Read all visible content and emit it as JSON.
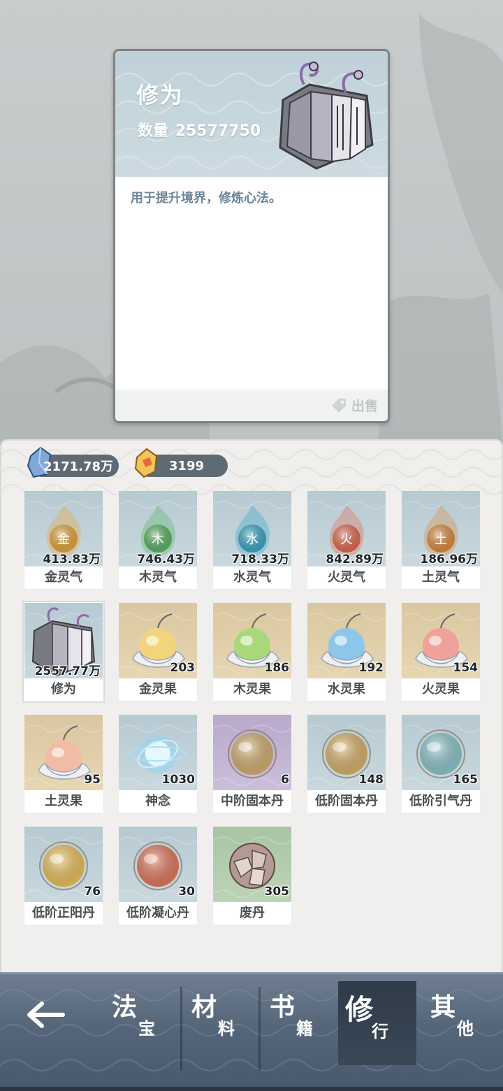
{
  "detail": {
    "title": "修为",
    "quantity_label": "数量",
    "quantity_value": "25577750",
    "description": "用于提升境界，修炼心法。",
    "sell_label": "出售"
  },
  "currencies": [
    {
      "icon": "spirit-stone-icon",
      "value": "2171.78万"
    },
    {
      "icon": "gold-ingot-icon",
      "value": "3199"
    }
  ],
  "items": [
    {
      "name": "金灵气",
      "count": "413.83万",
      "icon": "gold-qi-flame-icon",
      "element": "金",
      "color": "#e8a73a"
    },
    {
      "name": "木灵气",
      "count": "746.43万",
      "icon": "wood-qi-flame-icon",
      "element": "木",
      "color": "#5bb565"
    },
    {
      "name": "水灵气",
      "count": "718.33万",
      "icon": "water-qi-flame-icon",
      "element": "水",
      "color": "#3aa7c8"
    },
    {
      "name": "火灵气",
      "count": "842.89万",
      "icon": "fire-qi-flame-icon",
      "element": "火",
      "color": "#e46a4e"
    },
    {
      "name": "土灵气",
      "count": "186.96万",
      "icon": "earth-qi-flame-icon",
      "element": "土",
      "color": "#e08d3f"
    },
    {
      "name": "修为",
      "count": "2557.77万",
      "icon": "scroll-book-icon",
      "selected": true
    },
    {
      "name": "金灵果",
      "count": "203",
      "icon": "gold-spirit-fruit-icon",
      "color": "#f2d47c"
    },
    {
      "name": "木灵果",
      "count": "186",
      "icon": "wood-spirit-fruit-icon",
      "color": "#a9d87a"
    },
    {
      "name": "水灵果",
      "count": "192",
      "icon": "water-spirit-fruit-icon",
      "color": "#8cc6ea"
    },
    {
      "name": "火灵果",
      "count": "154",
      "icon": "fire-spirit-fruit-icon",
      "color": "#f0a19a"
    },
    {
      "name": "土灵果",
      "count": "95",
      "icon": "earth-spirit-fruit-icon",
      "color": "#f1bda6"
    },
    {
      "name": "神念",
      "count": "1030",
      "icon": "spirit-sense-orb-icon",
      "color": "#8fd3f5"
    },
    {
      "name": "中阶固本丹",
      "count": "6",
      "icon": "pill-icon",
      "color": "#d6b270"
    },
    {
      "name": "低阶固本丹",
      "count": "148",
      "icon": "pill-icon",
      "color": "#dcb56c"
    },
    {
      "name": "低阶引气丹",
      "count": "165",
      "icon": "pill-icon",
      "color": "#8fc9cf"
    },
    {
      "name": "低阶正阳丹",
      "count": "76",
      "icon": "pill-icon",
      "color": "#f0c45a"
    },
    {
      "name": "低阶凝心丹",
      "count": "30",
      "icon": "pill-icon",
      "color": "#e77a5c"
    },
    {
      "name": "废丹",
      "count": "305",
      "icon": "broken-pill-icon",
      "color": "#b49a92"
    }
  ],
  "nav": {
    "tabs": [
      {
        "big": "法",
        "small": "宝"
      },
      {
        "big": "材",
        "small": "料"
      },
      {
        "big": "书",
        "small": "籍"
      },
      {
        "big": "修",
        "small": "行",
        "active": true
      },
      {
        "big": "其",
        "small": "他"
      }
    ]
  },
  "colors": {
    "panel_bg": "#f0efed",
    "card_header": "#c7d7de",
    "nav_bg": "#55667a",
    "desc_text": "#6b8598"
  }
}
